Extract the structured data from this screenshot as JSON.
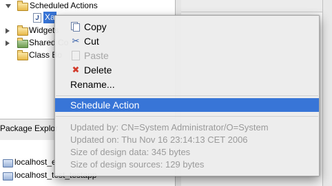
{
  "tree": {
    "items": [
      {
        "label": "Scheduled Actions",
        "expanded": true,
        "icon": "folder-icon"
      },
      {
        "label": "Xa",
        "icon": "java-file-icon",
        "selected": true
      },
      {
        "label": "Widgets",
        "expanded": false,
        "icon": "folder-icon"
      },
      {
        "label": "Shared Co",
        "expanded": false,
        "icon": "shared-folder-icon"
      },
      {
        "label": "Class Bo",
        "icon": "folder-icon"
      }
    ]
  },
  "package_explorer": {
    "title": "Package Explor",
    "projects": [
      {
        "label": "localhost_e",
        "icon": "project-icon"
      },
      {
        "label": "localhost_test_testapp",
        "icon": "project-icon"
      }
    ]
  },
  "context_menu": {
    "items": [
      {
        "label": "Copy",
        "icon": "copy-icon",
        "enabled": true
      },
      {
        "label": "Cut",
        "icon": "cut-icon",
        "enabled": true
      },
      {
        "label": "Paste",
        "icon": "paste-icon",
        "enabled": false
      },
      {
        "label": "Delete",
        "icon": "delete-icon",
        "enabled": true
      },
      {
        "label": "Rename...",
        "enabled": true
      },
      {
        "label": "Schedule Action",
        "enabled": true,
        "highlighted": true
      }
    ],
    "info_lines": [
      "Updated by: CN=System Administrator/O=System",
      "Updated on: Thu Nov 16 23:14:13 CET 2006",
      "Size of design data: 345 bytes",
      "Size of design sources: 129 bytes"
    ]
  },
  "colors": {
    "selection": "#3875d7",
    "menu_background": "#ececec",
    "disabled_text": "#a6a6a6",
    "info_text": "#9a9a9a",
    "delete_icon": "#d23b2b"
  }
}
